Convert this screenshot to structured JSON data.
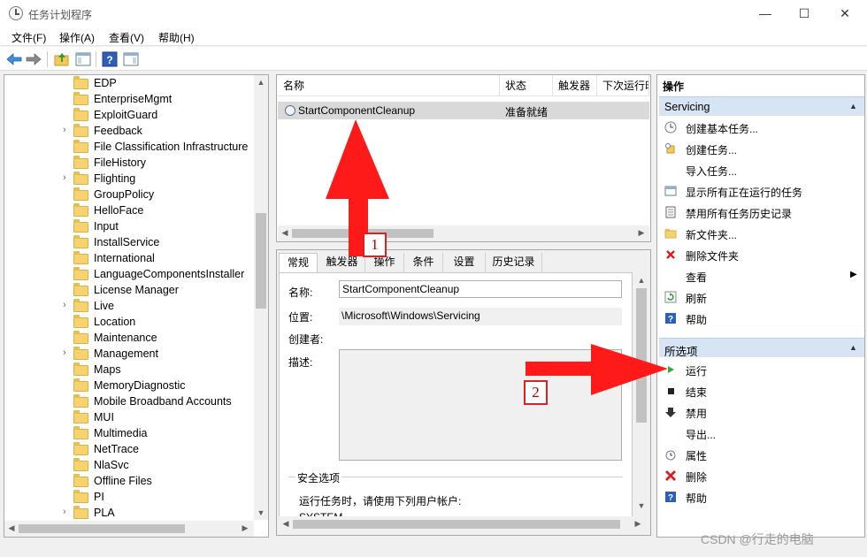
{
  "window": {
    "title": "任务计划程序",
    "minimize": "—",
    "maximize": "☐",
    "close": "✕"
  },
  "menu": [
    "文件(F)",
    "操作(A)",
    "查看(V)",
    "帮助(H)"
  ],
  "tree": {
    "items": [
      {
        "label": "EDP",
        "expandable": false
      },
      {
        "label": "EnterpriseMgmt",
        "expandable": false
      },
      {
        "label": "ExploitGuard",
        "expandable": false
      },
      {
        "label": "Feedback",
        "expandable": true
      },
      {
        "label": "File Classification Infrastructure",
        "expandable": false
      },
      {
        "label": "FileHistory",
        "expandable": false
      },
      {
        "label": "Flighting",
        "expandable": true
      },
      {
        "label": "GroupPolicy",
        "expandable": false
      },
      {
        "label": "HelloFace",
        "expandable": false
      },
      {
        "label": "Input",
        "expandable": false
      },
      {
        "label": "InstallService",
        "expandable": false
      },
      {
        "label": "International",
        "expandable": false
      },
      {
        "label": "LanguageComponentsInstaller",
        "expandable": false
      },
      {
        "label": "License Manager",
        "expandable": false
      },
      {
        "label": "Live",
        "expandable": true
      },
      {
        "label": "Location",
        "expandable": false
      },
      {
        "label": "Maintenance",
        "expandable": false
      },
      {
        "label": "Management",
        "expandable": true
      },
      {
        "label": "Maps",
        "expandable": false
      },
      {
        "label": "MemoryDiagnostic",
        "expandable": false
      },
      {
        "label": "Mobile Broadband Accounts",
        "expandable": false
      },
      {
        "label": "MUI",
        "expandable": false
      },
      {
        "label": "Multimedia",
        "expandable": false
      },
      {
        "label": "NetTrace",
        "expandable": false
      },
      {
        "label": "NlaSvc",
        "expandable": false
      },
      {
        "label": "Offline Files",
        "expandable": false
      },
      {
        "label": "PI",
        "expandable": false
      },
      {
        "label": "PLA",
        "expandable": true
      }
    ]
  },
  "tasklist": {
    "columns": [
      "名称",
      "状态",
      "触发器",
      "下次运行时"
    ],
    "rows": [
      {
        "name": "StartComponentCleanup",
        "status": "准备就绪"
      }
    ]
  },
  "detail": {
    "tabs": [
      "常规",
      "触发器",
      "操作",
      "条件",
      "设置",
      "历史记录"
    ],
    "name_label": "名称:",
    "name_value": "StartComponentCleanup",
    "location_label": "位置:",
    "location_value": "\\Microsoft\\Windows\\Servicing",
    "author_label": "创建者:",
    "desc_label": "描述:",
    "security_title": "安全选项",
    "security_line": "运行任务时，请使用下列用户帐户:",
    "security_user": "SYSTEM"
  },
  "actions": {
    "header": "操作",
    "group1_title": "Servicing",
    "group1": [
      {
        "label": "创建基本任务...",
        "icon": "create-basic-task-icon"
      },
      {
        "label": "创建任务...",
        "icon": "create-task-icon"
      },
      {
        "label": "导入任务...",
        "icon": ""
      },
      {
        "label": "显示所有正在运行的任务",
        "icon": "running-tasks-icon"
      },
      {
        "label": "禁用所有任务历史记录",
        "icon": "history-icon"
      },
      {
        "label": "新文件夹...",
        "icon": "new-folder-icon"
      },
      {
        "label": "删除文件夹",
        "icon": "delete-folder-icon"
      },
      {
        "label": "查看",
        "icon": "",
        "submenu": true
      },
      {
        "label": "刷新",
        "icon": "refresh-icon"
      },
      {
        "label": "帮助",
        "icon": "help-icon"
      }
    ],
    "group2_title": "所选项",
    "group2": [
      {
        "label": "运行",
        "icon": "run-icon"
      },
      {
        "label": "结束",
        "icon": "stop-icon"
      },
      {
        "label": "禁用",
        "icon": "disable-icon"
      },
      {
        "label": "导出...",
        "icon": ""
      },
      {
        "label": "属性",
        "icon": "properties-icon"
      },
      {
        "label": "删除",
        "icon": "delete-icon"
      },
      {
        "label": "帮助",
        "icon": "help-icon"
      }
    ]
  },
  "annotations": {
    "badge1": "1",
    "badge2": "2",
    "watermark": "CSDN @行走的电脑"
  },
  "colors": {
    "annotation_red": "#ff1a1a",
    "group_header_blue": "#d6e4f3",
    "selection_gray": "#d9d9d9"
  }
}
